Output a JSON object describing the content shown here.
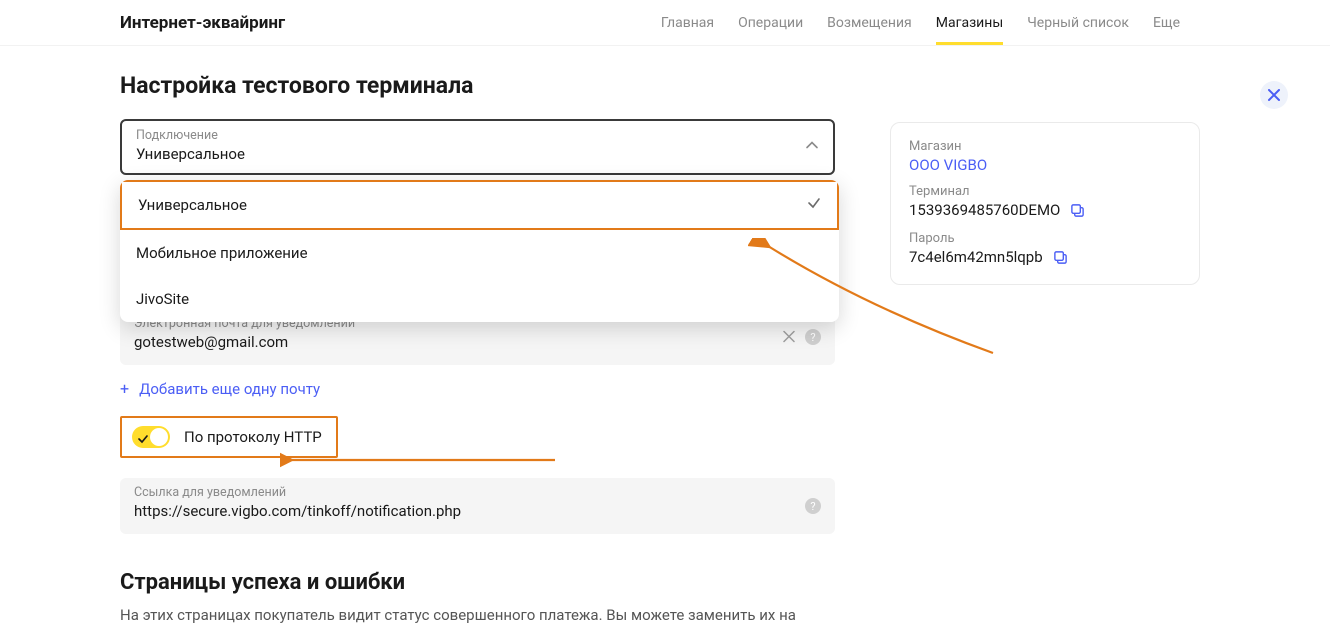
{
  "header": {
    "title": "Интернет-эквайринг",
    "nav": {
      "home": "Главная",
      "operations": "Операции",
      "refunds": "Возмещения",
      "shops": "Магазины",
      "blacklist": "Черный список",
      "more": "Еще"
    }
  },
  "page": {
    "title": "Настройка тестового терминала"
  },
  "select": {
    "label": "Подключение",
    "value": "Универсальное",
    "options": {
      "universal": "Универсальное",
      "mobile": "Мобильное приложение",
      "jivo": "JivoSite"
    }
  },
  "email": {
    "label": "Электронная почта для уведомлений",
    "value": "gotestweb@gmail.com"
  },
  "addMore": "Добавить еще одну почту",
  "httpToggle": {
    "label": "По протоколу HTTP"
  },
  "linkField": {
    "label": "Ссылка для уведомлений",
    "value": "https://secure.vigbo.com/tinkoff/notification.php"
  },
  "pagesSection": {
    "title": "Страницы успеха и ошибки",
    "desc": "На этих страницах покупатель видит статус совершенного платежа. Вы можете заменить их на"
  },
  "sidebar": {
    "shopLabel": "Магазин",
    "shopName": "ООО VIGBO",
    "terminalLabel": "Терминал",
    "terminalValue": "1539369485760DEMO",
    "passwordLabel": "Пароль",
    "passwordValue": "7c4el6m42mn5lqpb"
  }
}
